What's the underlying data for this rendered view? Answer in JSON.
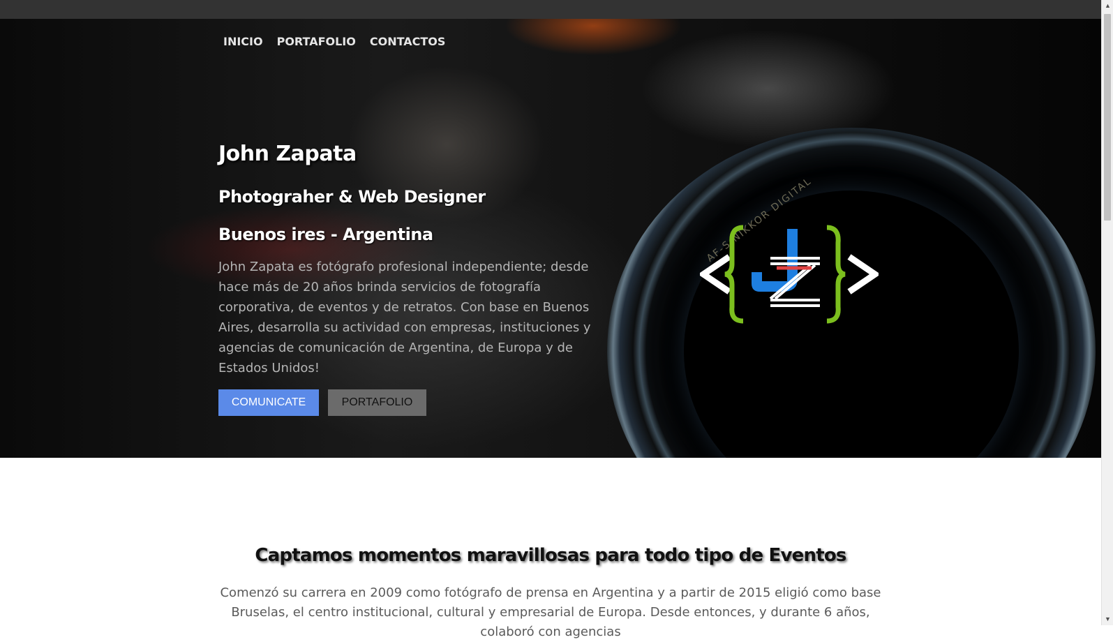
{
  "nav": {
    "items": [
      {
        "label": "INICIO"
      },
      {
        "label": "PORTAFOLIO"
      },
      {
        "label": "CONTACTOS"
      }
    ]
  },
  "hero": {
    "name": "John Zapata",
    "role": "Photograher & Web Designer",
    "location": "Buenos ires - Argentina",
    "description": "John Zapata es fotógrafo profesional independiente; desde hace más de 20 años brinda servicios de fotografía corporativa, de eventos y de retratos. Con base en Buenos Aires, desarrolla su actividad con empresas, instituciones y agencias de comunicación de Argentina, de Europa y de Estados Unidos!",
    "primary_button": "COMUNICATE",
    "secondary_button": "PORTAFOLIO",
    "lens_text": "AF-S NIKKOR DIGITAL"
  },
  "about": {
    "title": "Captamos momentos maravillosas para todo tipo de Eventos",
    "text": "Comenzó su carrera en 2009 como fotógrafo de prensa en Argentina y a partir de 2015 eligió como base Bruselas, el centro institucional, cultural y empresarial de Europa. Desde entonces, y durante 6 años, colaboró con agencias"
  },
  "colors": {
    "browser_bar": "#333333",
    "primary_button": "#5b8ae8",
    "secondary_button": "#6b6b6b",
    "logo_green": "#7cbf1e",
    "logo_blue": "#1e7fe0"
  }
}
